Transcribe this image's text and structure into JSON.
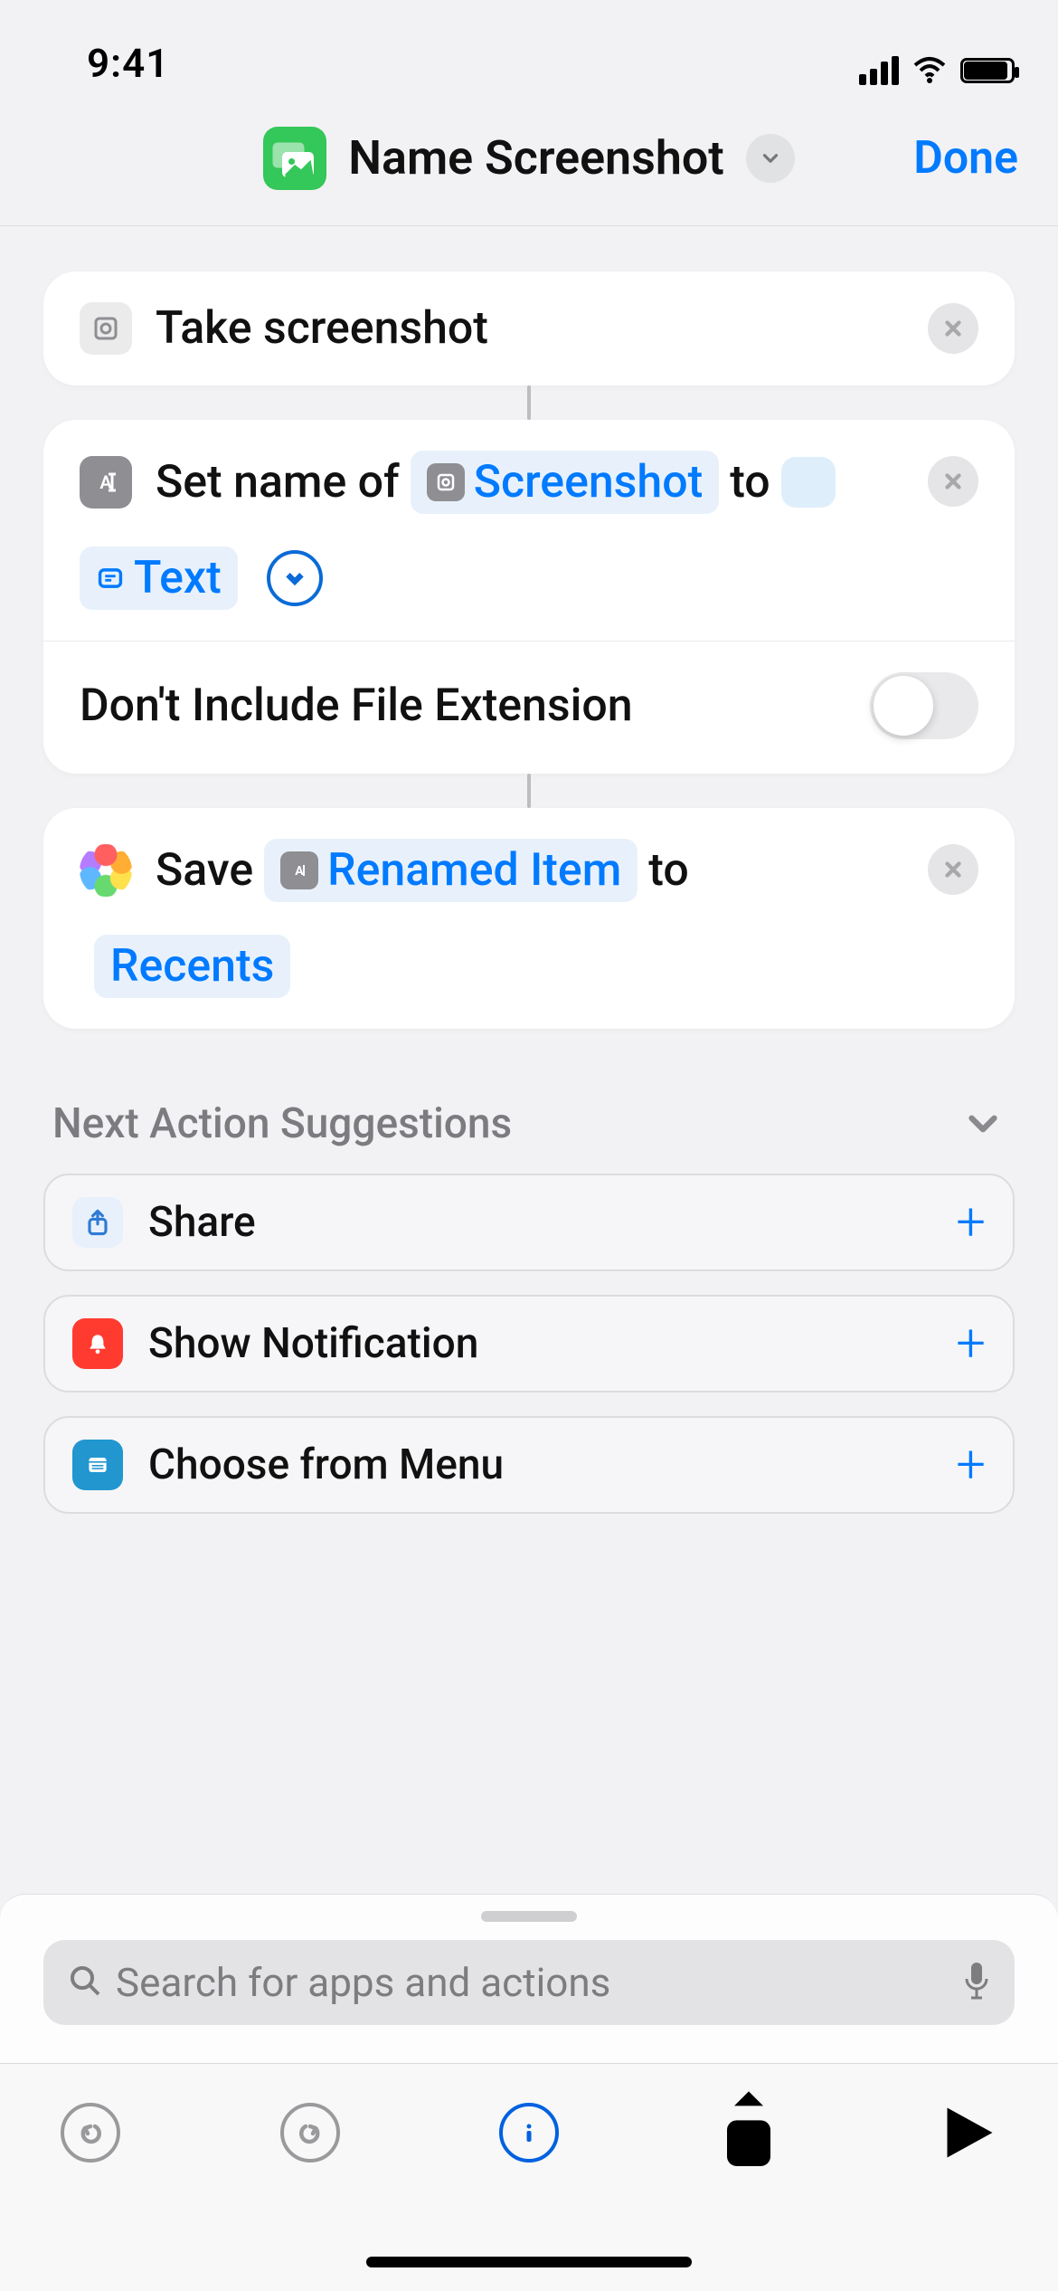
{
  "status": {
    "time": "9:41"
  },
  "header": {
    "title": "Name Screenshot",
    "done_label": "Done"
  },
  "actions": {
    "a1": {
      "label": "Take screenshot"
    },
    "a2": {
      "prefix": "Set name of",
      "token1": "Screenshot",
      "mid": "to",
      "token2": "Text"
    },
    "opt1": {
      "label": "Don't Include File Extension"
    },
    "a3": {
      "prefix": "Save",
      "token1": "Renamed Item",
      "mid": "to",
      "token2": "Recents"
    }
  },
  "suggestions": {
    "header": "Next Action Suggestions",
    "items": [
      {
        "label": "Share"
      },
      {
        "label": "Show Notification"
      },
      {
        "label": "Choose from Menu"
      }
    ]
  },
  "search": {
    "placeholder": "Search for apps and actions"
  }
}
